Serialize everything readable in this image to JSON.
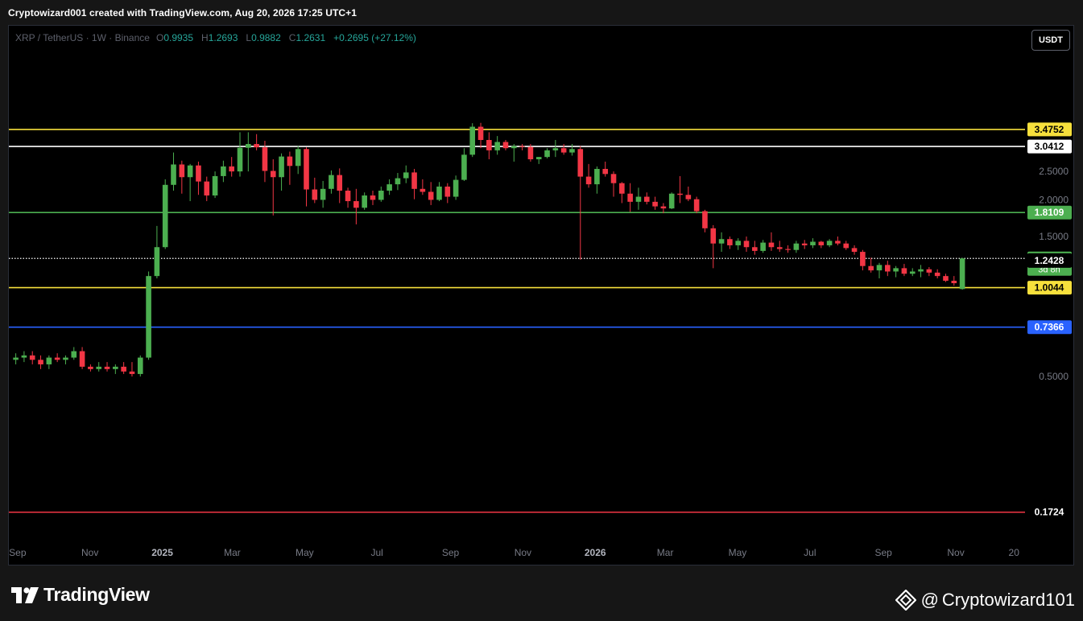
{
  "header": {
    "caption": "Cryptowizard001 created with TradingView.com, Aug 20, 2026 17:25 UTC+1"
  },
  "legend": {
    "symbol": "XRP / TetherUS · 1W · Binance",
    "open_key": "O",
    "open": "0.9935",
    "high_key": "H",
    "high": "1.2693",
    "low_key": "L",
    "low": "0.9882",
    "close_key": "C",
    "close": "1.2631",
    "change": "+0.2695 (+27.12%)"
  },
  "currency_button": "USDT",
  "footer": {
    "logo_text": "TradingView",
    "author": "Cryptowizard101"
  },
  "colors": {
    "bullish": "#4caf50",
    "bearish": "#f23645",
    "background": "#000000",
    "yellow_level": "#f7e03c",
    "white_level": "#ffffff",
    "green_level": "#4caf50",
    "blue_level": "#2962ff",
    "red_level": "#f23645"
  },
  "chart_data": {
    "type": "candlestick",
    "symbol": "XRP / TetherUS",
    "interval": "1W",
    "exchange": "Binance",
    "scale": "log",
    "x_range": [
      "2024-08-26",
      "2026-12-28"
    ],
    "y_range": [
      0.138,
      7.0
    ],
    "x_tick_labels": [
      {
        "label": "Sep",
        "date": "2024-09-01"
      },
      {
        "label": "Nov",
        "date": "2024-11-01"
      },
      {
        "label": "2025",
        "date": "2025-01-01",
        "bold": true
      },
      {
        "label": "Mar",
        "date": "2025-03-01"
      },
      {
        "label": "May",
        "date": "2025-05-01"
      },
      {
        "label": "Jul",
        "date": "2025-07-01"
      },
      {
        "label": "Sep",
        "date": "2025-09-01"
      },
      {
        "label": "Nov",
        "date": "2025-11-01"
      },
      {
        "label": "2026",
        "date": "2026-01-01",
        "bold": true
      },
      {
        "label": "Mar",
        "date": "2026-03-01"
      },
      {
        "label": "May",
        "date": "2026-05-01"
      },
      {
        "label": "Jul",
        "date": "2026-07-01"
      },
      {
        "label": "Sep",
        "date": "2026-09-01"
      },
      {
        "label": "Nov",
        "date": "2026-11-01"
      },
      {
        "label": "20",
        "date": "2026-12-20"
      }
    ],
    "y_tick_labels": [
      "2.5000",
      "2.0000",
      "1.5000",
      "0.5000"
    ],
    "y_tick_values": [
      2.5,
      2.0,
      1.5,
      0.5
    ],
    "horizontal_levels": [
      {
        "value": 3.4752,
        "label": "3.4752",
        "color": "#f7e03c",
        "label_bg": "#f7e03c",
        "label_fg": "#000000",
        "style": "solid"
      },
      {
        "value": 3.0412,
        "label": "3.0412",
        "color": "#ffffff",
        "label_bg": "#ffffff",
        "label_fg": "#000000",
        "style": "solid"
      },
      {
        "value": 1.8109,
        "label": "1.8109",
        "color": "#4caf50",
        "label_bg": "#4caf50",
        "label_fg": "#ffffff",
        "style": "solid"
      },
      {
        "value": 1.2631,
        "label": "1.2631",
        "sub_label": "3d 8h",
        "color": "#ffffff",
        "label_bg": "#4caf50",
        "label_fg": "#ffffff",
        "style": "dotted"
      },
      {
        "value": 1.2428,
        "label": "1.2428",
        "color": "none",
        "label_bg": "#000000",
        "label_fg": "#ffffff",
        "style": "none"
      },
      {
        "value": 1.0044,
        "label": "1.0044",
        "color": "#f7e03c",
        "label_bg": "#f7e03c",
        "label_fg": "#000000",
        "style": "solid"
      },
      {
        "value": 0.7366,
        "label": "0.7366",
        "color": "#2962ff",
        "label_bg": "#2962ff",
        "label_fg": "#ffffff",
        "style": "solid"
      },
      {
        "value": 0.1724,
        "label": "0.1724",
        "color": "#f23645",
        "label_bg": "#000000",
        "label_fg": "#ffffff",
        "style": "solid"
      }
    ],
    "candles": [
      {
        "d": "2024-08-26",
        "o": 0.57,
        "h": 0.6,
        "l": 0.55,
        "c": 0.58
      },
      {
        "d": "2024-09-02",
        "o": 0.58,
        "h": 0.61,
        "l": 0.56,
        "c": 0.59
      },
      {
        "d": "2024-09-09",
        "o": 0.59,
        "h": 0.61,
        "l": 0.55,
        "c": 0.57
      },
      {
        "d": "2024-09-16",
        "o": 0.57,
        "h": 0.59,
        "l": 0.53,
        "c": 0.55
      },
      {
        "d": "2024-09-23",
        "o": 0.55,
        "h": 0.59,
        "l": 0.53,
        "c": 0.58
      },
      {
        "d": "2024-09-30",
        "o": 0.58,
        "h": 0.6,
        "l": 0.56,
        "c": 0.57
      },
      {
        "d": "2024-10-07",
        "o": 0.57,
        "h": 0.59,
        "l": 0.55,
        "c": 0.58
      },
      {
        "d": "2024-10-14",
        "o": 0.58,
        "h": 0.63,
        "l": 0.57,
        "c": 0.61
      },
      {
        "d": "2024-10-21",
        "o": 0.61,
        "h": 0.63,
        "l": 0.53,
        "c": 0.54
      },
      {
        "d": "2024-10-28",
        "o": 0.54,
        "h": 0.55,
        "l": 0.52,
        "c": 0.53
      },
      {
        "d": "2024-11-04",
        "o": 0.53,
        "h": 0.56,
        "l": 0.52,
        "c": 0.54
      },
      {
        "d": "2024-11-11",
        "o": 0.54,
        "h": 0.56,
        "l": 0.52,
        "c": 0.53
      },
      {
        "d": "2024-11-18",
        "o": 0.53,
        "h": 0.55,
        "l": 0.51,
        "c": 0.54
      },
      {
        "d": "2024-11-25",
        "o": 0.54,
        "h": 0.56,
        "l": 0.51,
        "c": 0.52
      },
      {
        "d": "2024-12-02",
        "o": 0.52,
        "h": 0.56,
        "l": 0.5,
        "c": 0.51
      },
      {
        "d": "2024-12-09",
        "o": 0.51,
        "h": 0.59,
        "l": 0.5,
        "c": 0.58
      },
      {
        "d": "2024-12-16",
        "o": 0.58,
        "h": 1.14,
        "l": 0.57,
        "c": 1.1
      },
      {
        "d": "2024-12-23",
        "o": 1.1,
        "h": 1.63,
        "l": 1.08,
        "c": 1.38
      },
      {
        "d": "2024-12-30",
        "o": 1.38,
        "h": 2.35,
        "l": 1.36,
        "c": 2.25
      },
      {
        "d": "2025-01-06",
        "o": 2.25,
        "h": 2.9,
        "l": 2.15,
        "c": 2.64
      },
      {
        "d": "2025-01-13",
        "o": 2.64,
        "h": 2.72,
        "l": 2.1,
        "c": 2.39
      },
      {
        "d": "2025-01-20",
        "o": 2.39,
        "h": 2.65,
        "l": 1.98,
        "c": 2.62
      },
      {
        "d": "2025-01-27",
        "o": 2.62,
        "h": 2.7,
        "l": 2.08,
        "c": 2.31
      },
      {
        "d": "2025-02-03",
        "o": 2.31,
        "h": 2.4,
        "l": 1.98,
        "c": 2.07
      },
      {
        "d": "2025-02-10",
        "o": 2.07,
        "h": 2.5,
        "l": 2.03,
        "c": 2.41
      },
      {
        "d": "2025-02-17",
        "o": 2.41,
        "h": 2.72,
        "l": 2.3,
        "c": 2.6
      },
      {
        "d": "2025-02-24",
        "o": 2.6,
        "h": 2.8,
        "l": 2.4,
        "c": 2.5
      },
      {
        "d": "2025-03-03",
        "o": 2.5,
        "h": 3.4,
        "l": 2.4,
        "c": 3.01
      },
      {
        "d": "2025-03-10",
        "o": 3.01,
        "h": 3.4,
        "l": 2.5,
        "c": 3.1
      },
      {
        "d": "2025-03-17",
        "o": 3.1,
        "h": 3.35,
        "l": 2.95,
        "c": 3.02
      },
      {
        "d": "2025-03-24",
        "o": 3.02,
        "h": 3.18,
        "l": 2.3,
        "c": 2.51
      },
      {
        "d": "2025-03-31",
        "o": 2.51,
        "h": 2.75,
        "l": 1.77,
        "c": 2.39
      },
      {
        "d": "2025-04-07",
        "o": 2.39,
        "h": 2.88,
        "l": 2.15,
        "c": 2.81
      },
      {
        "d": "2025-04-14",
        "o": 2.81,
        "h": 2.92,
        "l": 2.25,
        "c": 2.61
      },
      {
        "d": "2025-04-21",
        "o": 2.61,
        "h": 3.05,
        "l": 2.45,
        "c": 2.98
      },
      {
        "d": "2025-04-28",
        "o": 2.98,
        "h": 3.02,
        "l": 1.9,
        "c": 2.17
      },
      {
        "d": "2025-05-05",
        "o": 2.17,
        "h": 2.38,
        "l": 1.95,
        "c": 2.0
      },
      {
        "d": "2025-05-12",
        "o": 2.0,
        "h": 2.32,
        "l": 1.88,
        "c": 2.18
      },
      {
        "d": "2025-05-19",
        "o": 2.18,
        "h": 2.52,
        "l": 2.1,
        "c": 2.43
      },
      {
        "d": "2025-05-26",
        "o": 2.43,
        "h": 2.56,
        "l": 1.95,
        "c": 2.15
      },
      {
        "d": "2025-06-02",
        "o": 2.15,
        "h": 2.2,
        "l": 1.88,
        "c": 1.98
      },
      {
        "d": "2025-06-09",
        "o": 1.98,
        "h": 2.18,
        "l": 1.65,
        "c": 1.88
      },
      {
        "d": "2025-06-16",
        "o": 1.88,
        "h": 2.12,
        "l": 1.85,
        "c": 2.07
      },
      {
        "d": "2025-06-23",
        "o": 2.07,
        "h": 2.15,
        "l": 1.92,
        "c": 2.0
      },
      {
        "d": "2025-06-30",
        "o": 2.0,
        "h": 2.22,
        "l": 1.97,
        "c": 2.15
      },
      {
        "d": "2025-07-07",
        "o": 2.15,
        "h": 2.35,
        "l": 2.08,
        "c": 2.26
      },
      {
        "d": "2025-07-14",
        "o": 2.26,
        "h": 2.47,
        "l": 2.16,
        "c": 2.37
      },
      {
        "d": "2025-07-21",
        "o": 2.37,
        "h": 2.62,
        "l": 2.28,
        "c": 2.48
      },
      {
        "d": "2025-07-28",
        "o": 2.48,
        "h": 2.55,
        "l": 2.01,
        "c": 2.18
      },
      {
        "d": "2025-08-04",
        "o": 2.18,
        "h": 2.35,
        "l": 2.08,
        "c": 2.13
      },
      {
        "d": "2025-08-11",
        "o": 2.13,
        "h": 2.3,
        "l": 1.92,
        "c": 2.0
      },
      {
        "d": "2025-08-18",
        "o": 2.0,
        "h": 2.3,
        "l": 1.98,
        "c": 2.22
      },
      {
        "d": "2025-08-25",
        "o": 2.22,
        "h": 2.28,
        "l": 1.95,
        "c": 2.05
      },
      {
        "d": "2025-09-01",
        "o": 2.05,
        "h": 2.42,
        "l": 2.0,
        "c": 2.34
      },
      {
        "d": "2025-09-08",
        "o": 2.34,
        "h": 3.0,
        "l": 2.32,
        "c": 2.85
      },
      {
        "d": "2025-09-15",
        "o": 2.85,
        "h": 3.65,
        "l": 2.8,
        "c": 3.55
      },
      {
        "d": "2025-09-22",
        "o": 3.55,
        "h": 3.66,
        "l": 3.0,
        "c": 3.2
      },
      {
        "d": "2025-09-29",
        "o": 3.2,
        "h": 3.4,
        "l": 2.75,
        "c": 2.95
      },
      {
        "d": "2025-10-06",
        "o": 2.95,
        "h": 3.3,
        "l": 2.85,
        "c": 3.15
      },
      {
        "d": "2025-10-13",
        "o": 3.15,
        "h": 3.2,
        "l": 2.95,
        "c": 3.0
      },
      {
        "d": "2025-10-20",
        "o": 3.0,
        "h": 3.1,
        "l": 2.7,
        "c": 3.05
      },
      {
        "d": "2025-10-27",
        "o": 3.05,
        "h": 3.1,
        "l": 2.95,
        "c": 3.03
      },
      {
        "d": "2025-11-03",
        "o": 3.03,
        "h": 3.1,
        "l": 2.7,
        "c": 2.75
      },
      {
        "d": "2025-11-10",
        "o": 2.75,
        "h": 2.8,
        "l": 2.65,
        "c": 2.8
      },
      {
        "d": "2025-11-17",
        "o": 2.8,
        "h": 3.0,
        "l": 2.77,
        "c": 2.95
      },
      {
        "d": "2025-11-24",
        "o": 2.95,
        "h": 3.2,
        "l": 2.8,
        "c": 3.0
      },
      {
        "d": "2025-12-01",
        "o": 3.0,
        "h": 3.1,
        "l": 2.85,
        "c": 2.9
      },
      {
        "d": "2025-12-08",
        "o": 2.9,
        "h": 3.1,
        "l": 2.83,
        "c": 2.98
      },
      {
        "d": "2025-12-15",
        "o": 2.98,
        "h": 3.05,
        "l": 1.25,
        "c": 2.4
      },
      {
        "d": "2025-12-22",
        "o": 2.4,
        "h": 2.65,
        "l": 2.2,
        "c": 2.26
      },
      {
        "d": "2025-12-29",
        "o": 2.26,
        "h": 2.6,
        "l": 2.1,
        "c": 2.55
      },
      {
        "d": "2026-01-05",
        "o": 2.55,
        "h": 2.7,
        "l": 2.4,
        "c": 2.45
      },
      {
        "d": "2026-01-12",
        "o": 2.45,
        "h": 2.5,
        "l": 2.05,
        "c": 2.28
      },
      {
        "d": "2026-01-19",
        "o": 2.28,
        "h": 2.3,
        "l": 1.95,
        "c": 2.1
      },
      {
        "d": "2026-01-26",
        "o": 2.1,
        "h": 2.28,
        "l": 1.82,
        "c": 1.97
      },
      {
        "d": "2026-02-02",
        "o": 1.97,
        "h": 2.2,
        "l": 1.85,
        "c": 2.05
      },
      {
        "d": "2026-02-09",
        "o": 2.05,
        "h": 2.12,
        "l": 1.93,
        "c": 1.97
      },
      {
        "d": "2026-02-16",
        "o": 1.97,
        "h": 2.05,
        "l": 1.85,
        "c": 1.9
      },
      {
        "d": "2026-02-23",
        "o": 1.9,
        "h": 1.95,
        "l": 1.8,
        "c": 1.87
      },
      {
        "d": "2026-03-02",
        "o": 1.87,
        "h": 2.12,
        "l": 1.86,
        "c": 2.1
      },
      {
        "d": "2026-03-09",
        "o": 2.1,
        "h": 2.41,
        "l": 1.95,
        "c": 2.08
      },
      {
        "d": "2026-03-16",
        "o": 2.08,
        "h": 2.22,
        "l": 1.98,
        "c": 2.01
      },
      {
        "d": "2026-03-23",
        "o": 2.01,
        "h": 2.05,
        "l": 1.8,
        "c": 1.83
      },
      {
        "d": "2026-03-30",
        "o": 1.83,
        "h": 1.85,
        "l": 1.55,
        "c": 1.6
      },
      {
        "d": "2026-04-06",
        "o": 1.6,
        "h": 1.64,
        "l": 1.17,
        "c": 1.42
      },
      {
        "d": "2026-04-13",
        "o": 1.42,
        "h": 1.55,
        "l": 1.33,
        "c": 1.47
      },
      {
        "d": "2026-04-20",
        "o": 1.47,
        "h": 1.5,
        "l": 1.36,
        "c": 1.4
      },
      {
        "d": "2026-04-27",
        "o": 1.4,
        "h": 1.48,
        "l": 1.35,
        "c": 1.45
      },
      {
        "d": "2026-05-04",
        "o": 1.45,
        "h": 1.5,
        "l": 1.33,
        "c": 1.38
      },
      {
        "d": "2026-05-11",
        "o": 1.38,
        "h": 1.45,
        "l": 1.3,
        "c": 1.34
      },
      {
        "d": "2026-05-18",
        "o": 1.34,
        "h": 1.46,
        "l": 1.32,
        "c": 1.43
      },
      {
        "d": "2026-05-25",
        "o": 1.43,
        "h": 1.55,
        "l": 1.34,
        "c": 1.38
      },
      {
        "d": "2026-06-01",
        "o": 1.38,
        "h": 1.45,
        "l": 1.33,
        "c": 1.36
      },
      {
        "d": "2026-06-08",
        "o": 1.36,
        "h": 1.4,
        "l": 1.32,
        "c": 1.35
      },
      {
        "d": "2026-06-15",
        "o": 1.35,
        "h": 1.45,
        "l": 1.32,
        "c": 1.42
      },
      {
        "d": "2026-06-22",
        "o": 1.42,
        "h": 1.46,
        "l": 1.36,
        "c": 1.4
      },
      {
        "d": "2026-06-29",
        "o": 1.4,
        "h": 1.48,
        "l": 1.37,
        "c": 1.44
      },
      {
        "d": "2026-07-06",
        "o": 1.44,
        "h": 1.45,
        "l": 1.37,
        "c": 1.4
      },
      {
        "d": "2026-07-13",
        "o": 1.4,
        "h": 1.47,
        "l": 1.38,
        "c": 1.45
      },
      {
        "d": "2026-07-20",
        "o": 1.45,
        "h": 1.5,
        "l": 1.4,
        "c": 1.42
      },
      {
        "d": "2026-07-27",
        "o": 1.42,
        "h": 1.45,
        "l": 1.35,
        "c": 1.37
      },
      {
        "d": "2026-08-03",
        "o": 1.37,
        "h": 1.4,
        "l": 1.3,
        "c": 1.33
      },
      {
        "d": "2026-08-10",
        "o": 1.33,
        "h": 1.35,
        "l": 1.15,
        "c": 1.19
      },
      {
        "d": "2026-08-17",
        "o": 1.19,
        "h": 1.27,
        "l": 1.13,
        "c": 1.15
      },
      {
        "d": "2026-08-24",
        "o": 1.15,
        "h": 1.22,
        "l": 1.08,
        "c": 1.2
      },
      {
        "d": "2026-08-31",
        "o": 1.2,
        "h": 1.24,
        "l": 1.1,
        "c": 1.14
      },
      {
        "d": "2026-09-07",
        "o": 1.14,
        "h": 1.19,
        "l": 1.09,
        "c": 1.17
      },
      {
        "d": "2026-09-14",
        "o": 1.17,
        "h": 1.21,
        "l": 1.1,
        "c": 1.12
      },
      {
        "d": "2026-09-21",
        "o": 1.12,
        "h": 1.17,
        "l": 1.1,
        "c": 1.14
      },
      {
        "d": "2026-09-28",
        "o": 1.14,
        "h": 1.2,
        "l": 1.09,
        "c": 1.16
      },
      {
        "d": "2026-10-05",
        "o": 1.16,
        "h": 1.18,
        "l": 1.1,
        "c": 1.13
      },
      {
        "d": "2026-10-12",
        "o": 1.13,
        "h": 1.16,
        "l": 1.08,
        "c": 1.1
      },
      {
        "d": "2026-10-19",
        "o": 1.1,
        "h": 1.12,
        "l": 1.05,
        "c": 1.06
      },
      {
        "d": "2026-10-26",
        "o": 1.06,
        "h": 1.1,
        "l": 1.02,
        "c": 1.04
      },
      {
        "d": "2026-11-02",
        "o": 0.9935,
        "h": 1.2693,
        "l": 0.9882,
        "c": 1.2631
      }
    ]
  }
}
